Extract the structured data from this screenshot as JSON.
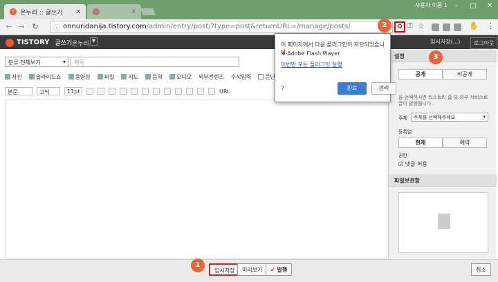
{
  "browser": {
    "tabs": [
      {
        "label": "온누리 :: 글쓰기",
        "close": "x"
      },
      {
        "label": "",
        "close": "x"
      }
    ],
    "window_user": "사용자 이름 1",
    "url_domain": "onnuridanija.tistory.com",
    "url_path": "/admin/entry/post/?type=post&returnURL=/manage/posts/"
  },
  "header": {
    "logo": "TISTORY",
    "section": "글쓰기",
    "blog": "온누리",
    "temp_save": "임시저장(...)",
    "logout": "로그아웃"
  },
  "editor": {
    "category": "분류 전체보기",
    "title_placeholder": "제목",
    "toolbar1": [
      "사진",
      "슬라이드쇼",
      "동영상",
      "파일",
      "지도",
      "음악",
      "오디오",
      "외부컨텐츠",
      "수식입력",
      "문단 간격 없음"
    ],
    "toolbar2": {
      "style": "본문",
      "font": "고딕",
      "size": "11pt",
      "url": "URL"
    }
  },
  "popup": {
    "message": "이 페이지에서 다음 플러그인이 차단되었습니다.",
    "plugin": "Adobe Flash Player",
    "link": "이번만 모든 플러그인 실행",
    "done": "완료",
    "manage": "관리"
  },
  "sidebar": {
    "head1": "설정",
    "public": "공개",
    "private": "비공개",
    "hint": "을 선택하시면 티스토리 홈 및 외부 서비스로 글이 발행됩니다.",
    "topic_label": "주제",
    "topic_value": "주제를 선택해주세요",
    "date_label": "등록일",
    "now": "현재",
    "reserve": "예약",
    "perm_label": "권한",
    "comment": "댓글 허용",
    "files_head": "파일보관함"
  },
  "bottom": {
    "tempsave": "임시저장",
    "preview": "미리보기",
    "publish": "발행",
    "cancel": "취소"
  },
  "markers": [
    "1",
    "2",
    "3"
  ]
}
